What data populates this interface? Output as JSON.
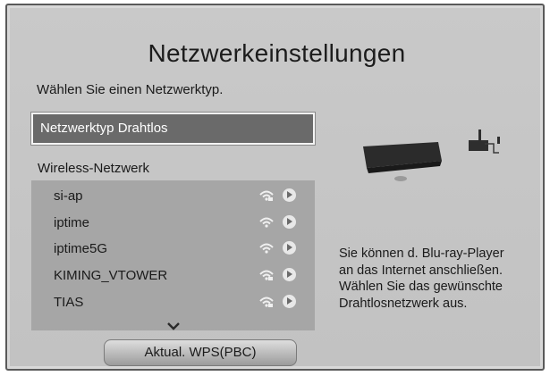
{
  "dialog": {
    "title": "Netzwerkeinstellungen",
    "subtitle": "Wählen Sie einen Netzwerktyp."
  },
  "network_type": {
    "label": "Netzwerktyp Drahtlos"
  },
  "wireless": {
    "label": "Wireless-Netzwerk",
    "networks": [
      {
        "name": "si-ap",
        "signal_icon": "wifi-locked-icon"
      },
      {
        "name": "iptime",
        "signal_icon": "wifi-icon"
      },
      {
        "name": "iptime5G",
        "signal_icon": "wifi-icon"
      },
      {
        "name": "KIMING_VTOWER",
        "signal_icon": "wifi-locked-icon"
      },
      {
        "name": "TIAS",
        "signal_icon": "wifi-locked-icon"
      }
    ]
  },
  "buttons": {
    "wps_label": "Aktual. WPS(PBC)"
  },
  "info": {
    "lines": [
      "Sie können d. Blu-ray-Player",
      "an das Internet anschließen.",
      "Wählen Sie das gewünschte",
      "Drahtlosnetzwerk aus."
    ]
  },
  "colors": {
    "background": "#c5c5c5",
    "selection": "#6a6a6a",
    "list_background": "#a6a6a6"
  }
}
